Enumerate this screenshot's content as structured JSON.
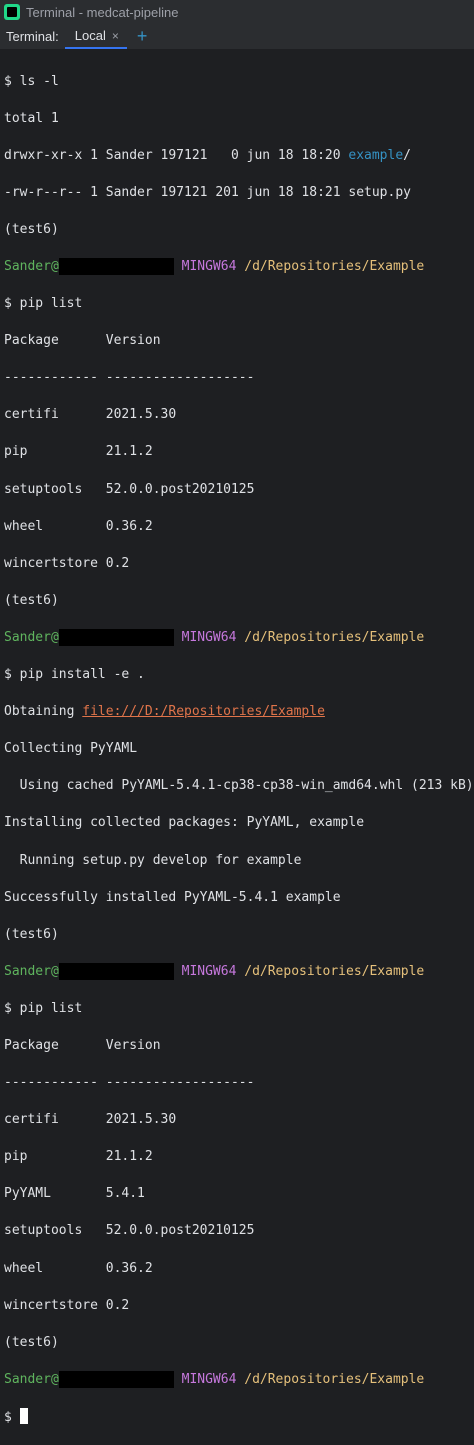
{
  "window": {
    "title": "Terminal - medcat-pipeline"
  },
  "tabs": {
    "label": "Terminal:",
    "active": "Local",
    "close": "×",
    "add": "+"
  },
  "prompt": {
    "user_at": "Sander@",
    "env": "MINGW64",
    "path": "/d/Repositories/Example",
    "conda_env": "(test6)",
    "sign": "$"
  },
  "session": {
    "cmd1": "ls -l",
    "ls": {
      "total": "total 1",
      "row1_prefix": "drwxr-xr-x 1 Sander 197121   0 jun 18 18:20 ",
      "row1_name": "example",
      "row1_suffix": "/",
      "row2": "-rw-r--r-- 1 Sander 197121 201 jun 18 18:21 setup.py"
    },
    "cmd2": "pip list",
    "header": "Package      Version",
    "divider": "------------ -------------------",
    "list1": [
      "certifi      2021.5.30",
      "pip          21.1.2",
      "setuptools   52.0.0.post20210125",
      "wheel        0.36.2",
      "wincertstore 0.2"
    ],
    "cmd3": "pip install -e .",
    "install": {
      "obtaining": "Obtaining ",
      "obtaining_link": "file:///D:/Repositories/Example",
      "collecting": "Collecting PyYAML",
      "cached": "  Using cached PyYAML-5.4.1-cp38-cp38-win_amd64.whl (213 kB)",
      "installing": "Installing collected packages: PyYAML, example",
      "running": "  Running setup.py develop for example",
      "success": "Successfully installed PyYAML-5.4.1 example"
    },
    "cmd4": "pip list",
    "list2": [
      "certifi      2021.5.30",
      "pip          21.1.2",
      "PyYAML       5.4.1",
      "setuptools   52.0.0.post20210125",
      "wheel        0.36.2",
      "wincertstore 0.2"
    ]
  },
  "colors": {
    "background": "#1e1f22",
    "prompt_user": "#5fb45e",
    "prompt_env": "#c678dd",
    "prompt_path": "#e5c07b",
    "dir": "#3592c4",
    "link": "#e0744a"
  }
}
